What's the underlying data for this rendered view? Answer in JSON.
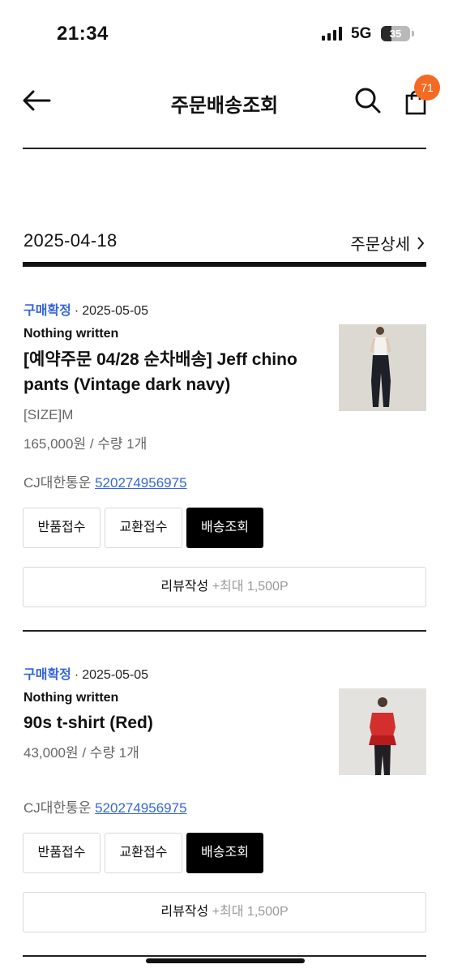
{
  "status_bar": {
    "time": "21:34",
    "network": "5G",
    "battery": "35",
    "battery_level": 0.35,
    "icons": [
      "signal-icon",
      "battery-icon"
    ]
  },
  "header": {
    "title": "주문배송조회",
    "cart_count": "71",
    "badge_color": "#f36b23",
    "icons": [
      "back-arrow-icon",
      "search-icon",
      "shopping-bag-icon"
    ]
  },
  "order": {
    "date": "2025-04-18",
    "detail_label": "주문상세",
    "detail_icon": "chevron-right-icon"
  },
  "items": [
    {
      "status": "구매확정",
      "separator": "·",
      "date": "2025-05-05",
      "brand": "Nothing written",
      "name": "[예약주문 04/28 순차배송] Jeff chino pants (Vintage dark navy)",
      "option": "[SIZE]M",
      "price": "165,000원 / 수량 1개",
      "courier": "CJ대한통운",
      "tracking": "520274956975",
      "buttons": [
        "반품접수",
        "교환접수",
        "배송조회"
      ],
      "review_label": "리뷰작성",
      "review_point": "+최대 1,500P"
    },
    {
      "status": "구매확정",
      "separator": "·",
      "date": "2025-05-05",
      "brand": "Nothing written",
      "name": "90s t-shirt (Red)",
      "price": "43,000원 / 수량 1개",
      "courier": "CJ대한통운",
      "tracking": "520274956975",
      "buttons": [
        "반품접수",
        "교환접수",
        "배송조회"
      ],
      "review_label": "리뷰작성",
      "review_point": "+최대 1,500P"
    }
  ],
  "colors": {
    "accent_blue": "#3466d8",
    "badge_orange": "#f36b23",
    "primary_button": "#000000"
  }
}
